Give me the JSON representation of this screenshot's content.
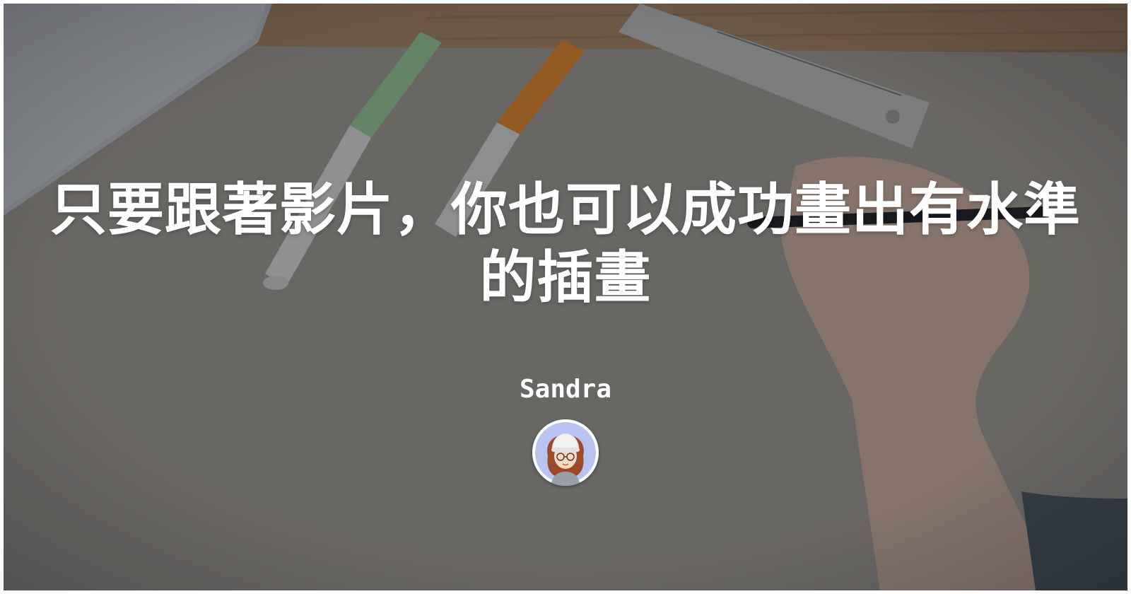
{
  "post": {
    "title": "只要跟著影片，你也可以成功畫出有水準的插畫",
    "author": "Sandra"
  },
  "icons": {
    "avatar": "author-avatar-illustration"
  },
  "colors": {
    "title_text": "#ffffff",
    "author_text": "#ffffff",
    "overlay": "rgba(20,22,28,0.42)",
    "paper": "#a8a298"
  }
}
